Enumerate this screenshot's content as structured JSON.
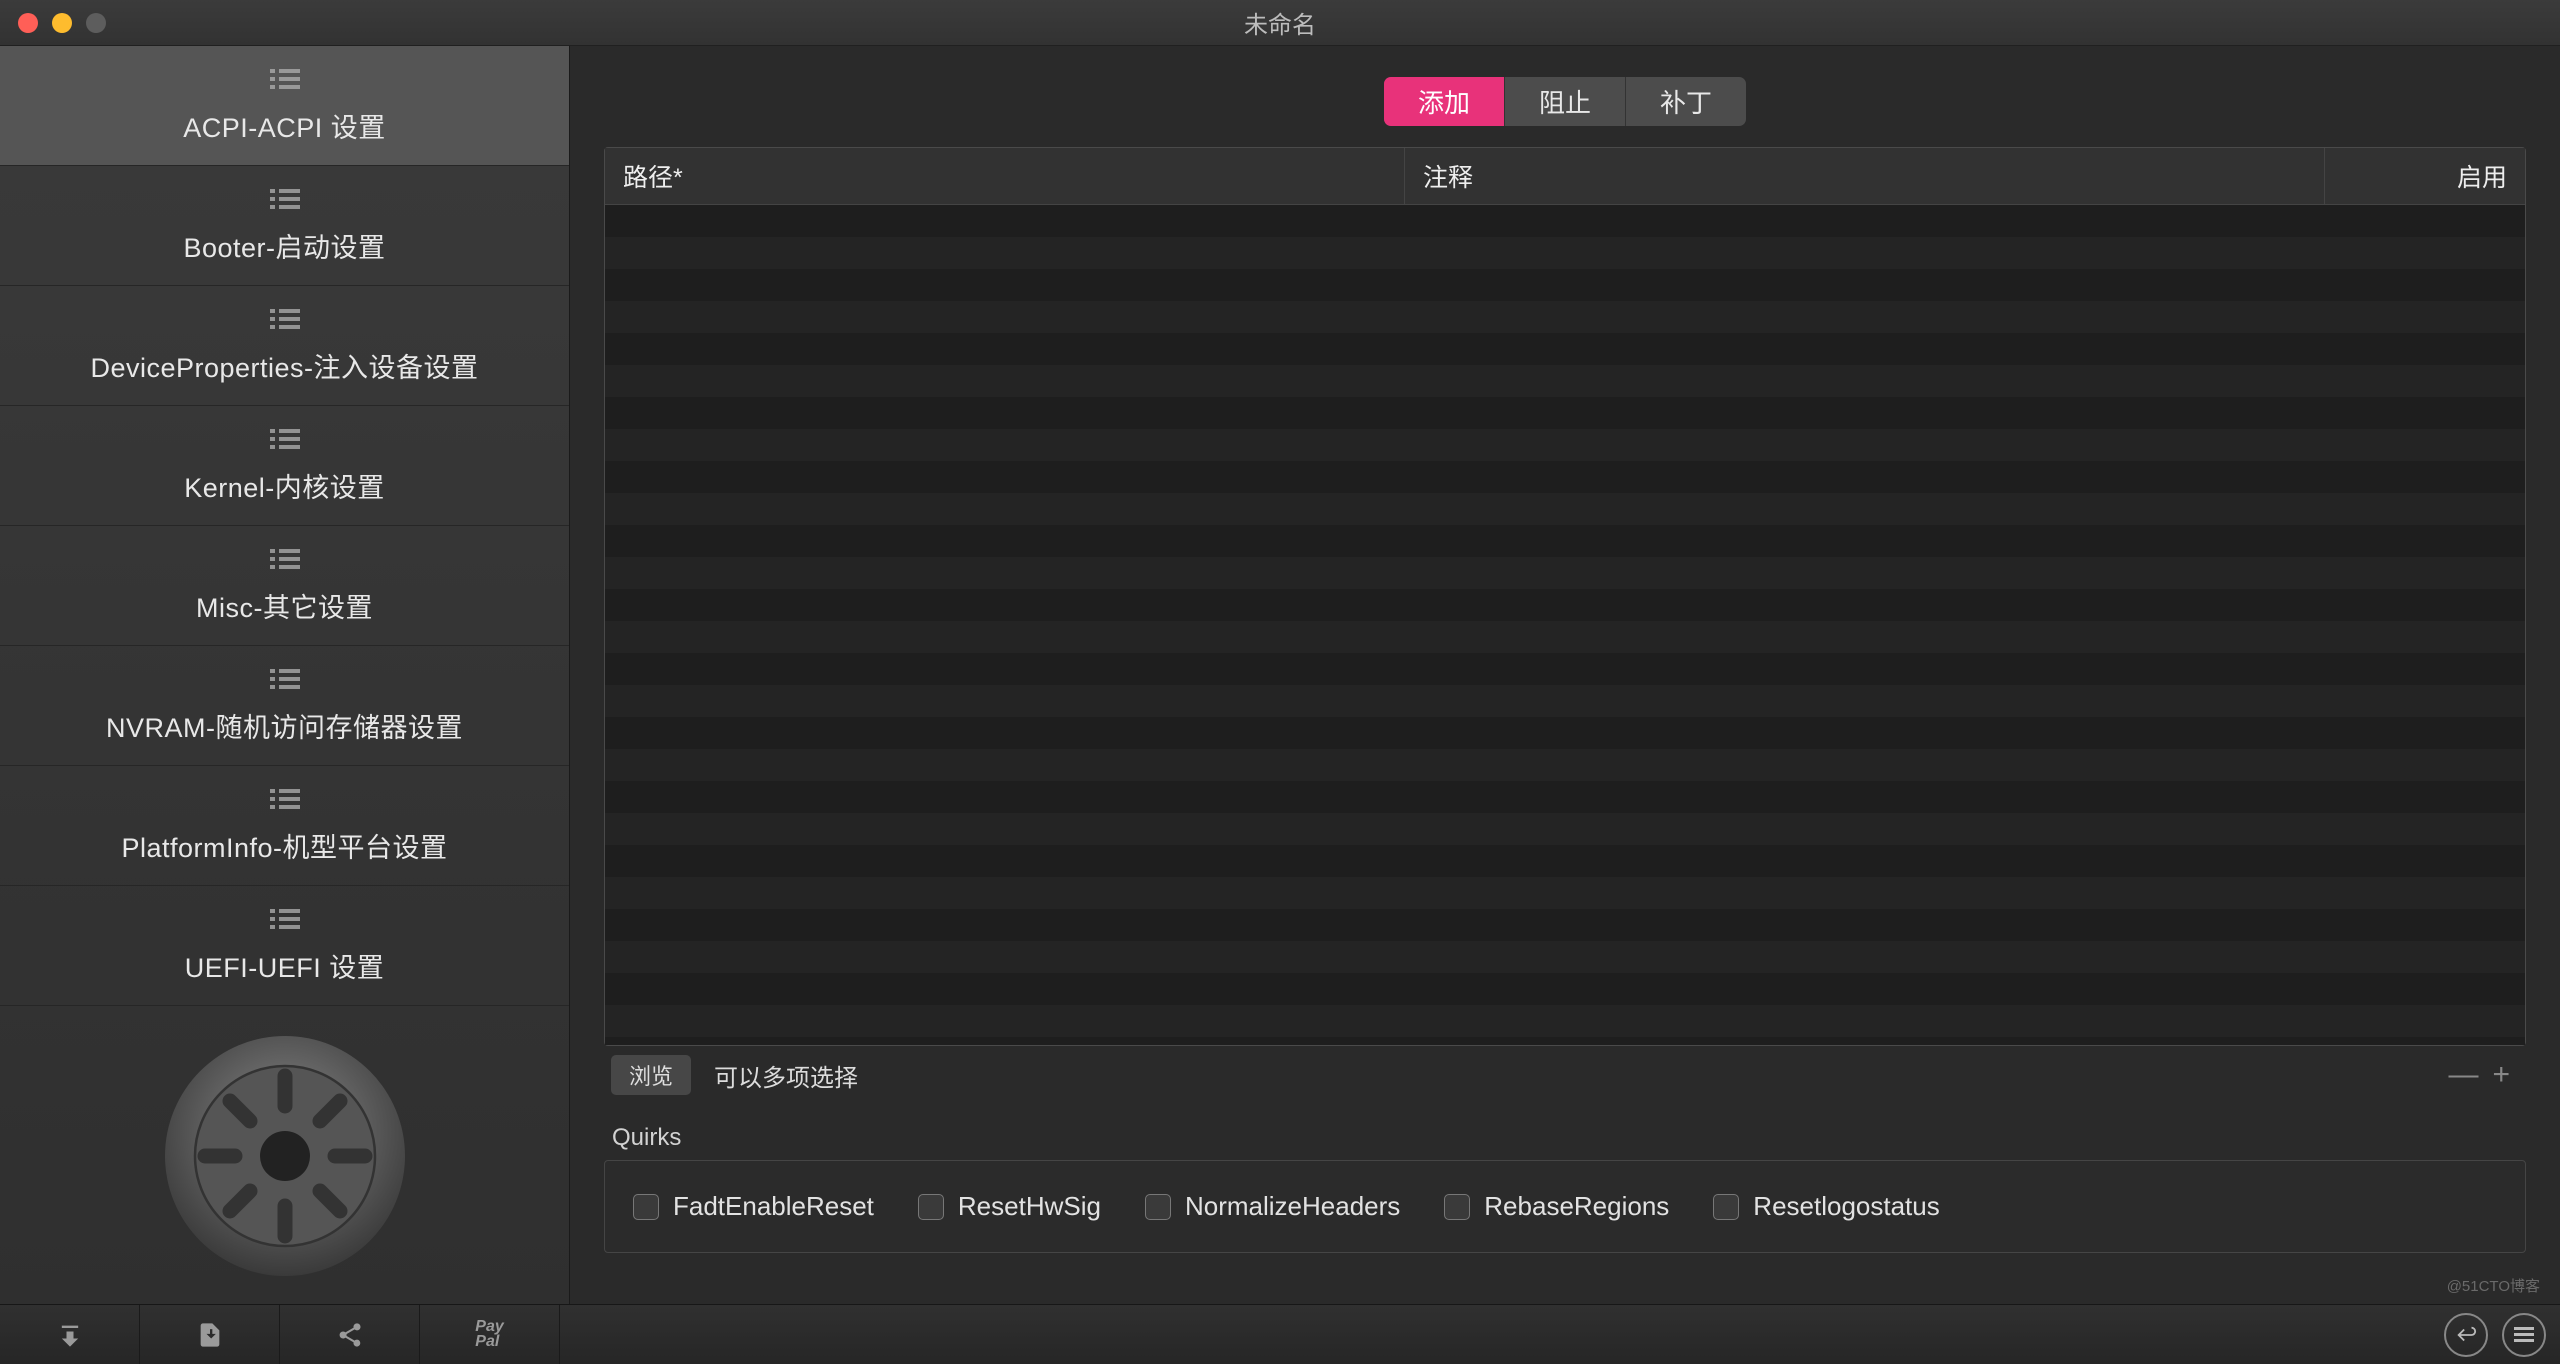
{
  "window": {
    "title": "未命名"
  },
  "sidebar": {
    "items": [
      {
        "label": "ACPI-ACPI 设置",
        "active": true
      },
      {
        "label": "Booter-启动设置",
        "active": false
      },
      {
        "label": "DeviceProperties-注入设备设置",
        "active": false
      },
      {
        "label": "Kernel-内核设置",
        "active": false
      },
      {
        "label": "Misc-其它设置",
        "active": false
      },
      {
        "label": "NVRAM-随机访问存储器设置",
        "active": false
      },
      {
        "label": "PlatformInfo-机型平台设置",
        "active": false
      },
      {
        "label": "UEFI-UEFI 设置",
        "active": false
      }
    ]
  },
  "tabs": {
    "items": [
      {
        "label": "添加",
        "active": true
      },
      {
        "label": "阻止",
        "active": false
      },
      {
        "label": "补丁",
        "active": false
      }
    ]
  },
  "table": {
    "headers": {
      "path": "路径*",
      "comment": "注释",
      "enable": "启用"
    },
    "rows": []
  },
  "footer": {
    "browse_label": "浏览",
    "hint": "可以多项选择",
    "minus": "—",
    "plus": "+"
  },
  "quirks": {
    "section_label": "Quirks",
    "items": [
      {
        "label": "FadtEnableReset",
        "checked": false
      },
      {
        "label": "ResetHwSig",
        "checked": false
      },
      {
        "label": "NormalizeHeaders",
        "checked": false
      },
      {
        "label": "RebaseRegions",
        "checked": false
      },
      {
        "label": "Resetlogostatus",
        "checked": false
      }
    ]
  },
  "bottombar": {
    "paypal_top": "Pay",
    "paypal_bottom": "Pal"
  },
  "watermark": "@51CTO博客"
}
